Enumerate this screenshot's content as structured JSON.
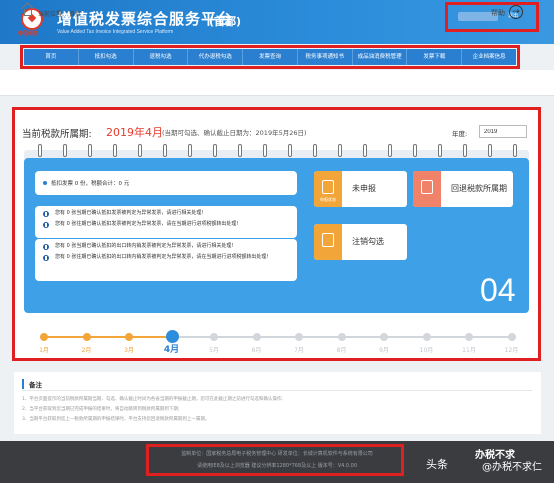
{
  "header": {
    "logo_text": "中国税务",
    "title": "增值税发票综合服务平台",
    "region": "(首都)",
    "subtitle": "Value Added Tax Invoice Integrated Service Platform",
    "logout_label": "退出"
  },
  "nav": {
    "items": [
      "首页",
      "抵扣勾选",
      "退税勾选",
      "代办退税勾选",
      "发票查询",
      "税务事项通知书",
      "成品油消费税管理",
      "发票下载",
      "企业档案信息"
    ]
  },
  "breadcrumb": {
    "label": "当前位置:",
    "value": "首页",
    "help_label": "帮助"
  },
  "period": {
    "label": "当前税款所属期:",
    "value": "2019年4月",
    "note": "(当期可勾选、确认截止日期为：2019年5月26日)",
    "year_label": "年度:",
    "year_value": "2019"
  },
  "summary": {
    "text": "抵扣发票 0 份，税额合计：0 元"
  },
  "notices": [
    "您有 0 张当期已确认抵扣发票被判定为异常发票，请进行相关处理!",
    "您有 0 张往期已确认抵扣发票被判定为异常发票，请在当期进行进项税额转出处理!",
    "您有 0 张当期已确认抵扣的出口转内销发票被判定为异常发票，请进行相关处理!",
    "您有 0 张往期已确认抵扣的出口转内销发票被判定为异常发票，请在当期进行进项税额转出处理!"
  ],
  "actions": {
    "declare_status_label": "申报状态",
    "declare_status": "未申报",
    "rollback_label": "回退税款所属期",
    "cancel_label": "注销勾选"
  },
  "big_month": "04",
  "timeline": {
    "months": [
      "1月",
      "2月",
      "3月",
      "4月",
      "5月",
      "6月",
      "7月",
      "8月",
      "9月",
      "10月",
      "11月",
      "12月"
    ],
    "current_index": 3
  },
  "notes": {
    "title": "备注",
    "lines": [
      "1、平台页面提示的当前税款所属期当期、勾选、确认截止时间为各省当期的申报截止期，您可在此截止期之前进行勾选和确认操作;",
      "2、当平台获取到您当期已完成申报的结果时，将自动跳转到税款所属期到下期;",
      "3、当期平台获取到您上一税款所属期的申报结果时，平台支持您回退税款所属期到上一属期。"
    ]
  },
  "footer": {
    "line1": "监制单位：国家税务总局电子税务管理中心    研发单位：长城计算机软件与系统有限公司",
    "line2": "请使用IE8及以上浏览器    建议分辨率1280*768及以上    版本号：V4.0.00"
  },
  "watermark": {
    "platform": "头条",
    "account": "办税不求",
    "sub": "@办税不求仁"
  },
  "colors": {
    "header_blue": "#2b8ddb",
    "nav_blue": "#2b7fd0",
    "calendar_blue": "#3ea0e6",
    "accent_red": "#e63b2e",
    "orange": "#f2a63a",
    "salmon": "#f0826a",
    "highlight_frame": "#e02020"
  }
}
